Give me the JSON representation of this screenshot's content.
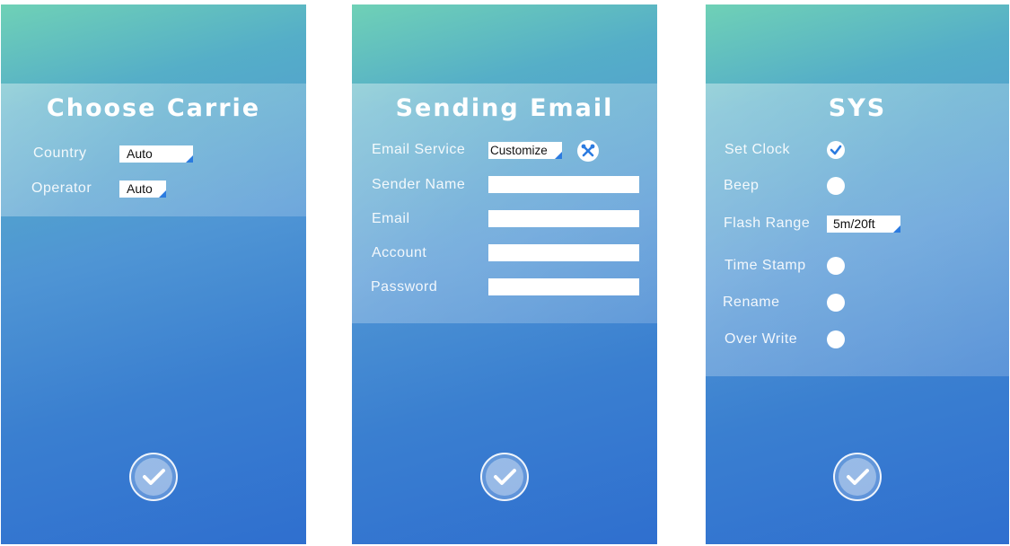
{
  "carrier": {
    "title": "Choose Carrie",
    "country_label": "Country",
    "country_value": "Auto",
    "operator_label": "Operator",
    "operator_value": "Auto"
  },
  "email": {
    "title": "Sending Email",
    "service_label": "Email Service",
    "service_value": "Customize",
    "sender_name_label": "Sender Name",
    "email_label": "Email",
    "account_label": "Account",
    "password_label": "Password",
    "sender_name_value": "",
    "email_value": "",
    "account_value": "",
    "password_value": ""
  },
  "sys": {
    "title": "SYS",
    "set_clock_label": "Set Clock",
    "set_clock_checked": true,
    "beep_label": "Beep",
    "beep_checked": false,
    "flash_range_label": "Flash Range",
    "flash_range_value": "5m/20ft",
    "time_stamp_label": "Time Stamp",
    "time_stamp_checked": false,
    "rename_label": "Rename",
    "rename_checked": false,
    "over_write_label": "Over Write",
    "over_write_checked": false
  },
  "icons": {
    "confirm": "check-circle-icon",
    "settings": "tools-icon",
    "dropdown": "dropdown-corner-icon"
  },
  "colors": {
    "accent": "#2b7be0",
    "gradient_top": "#6fd1b6",
    "gradient_bottom": "#2f6fcf"
  }
}
